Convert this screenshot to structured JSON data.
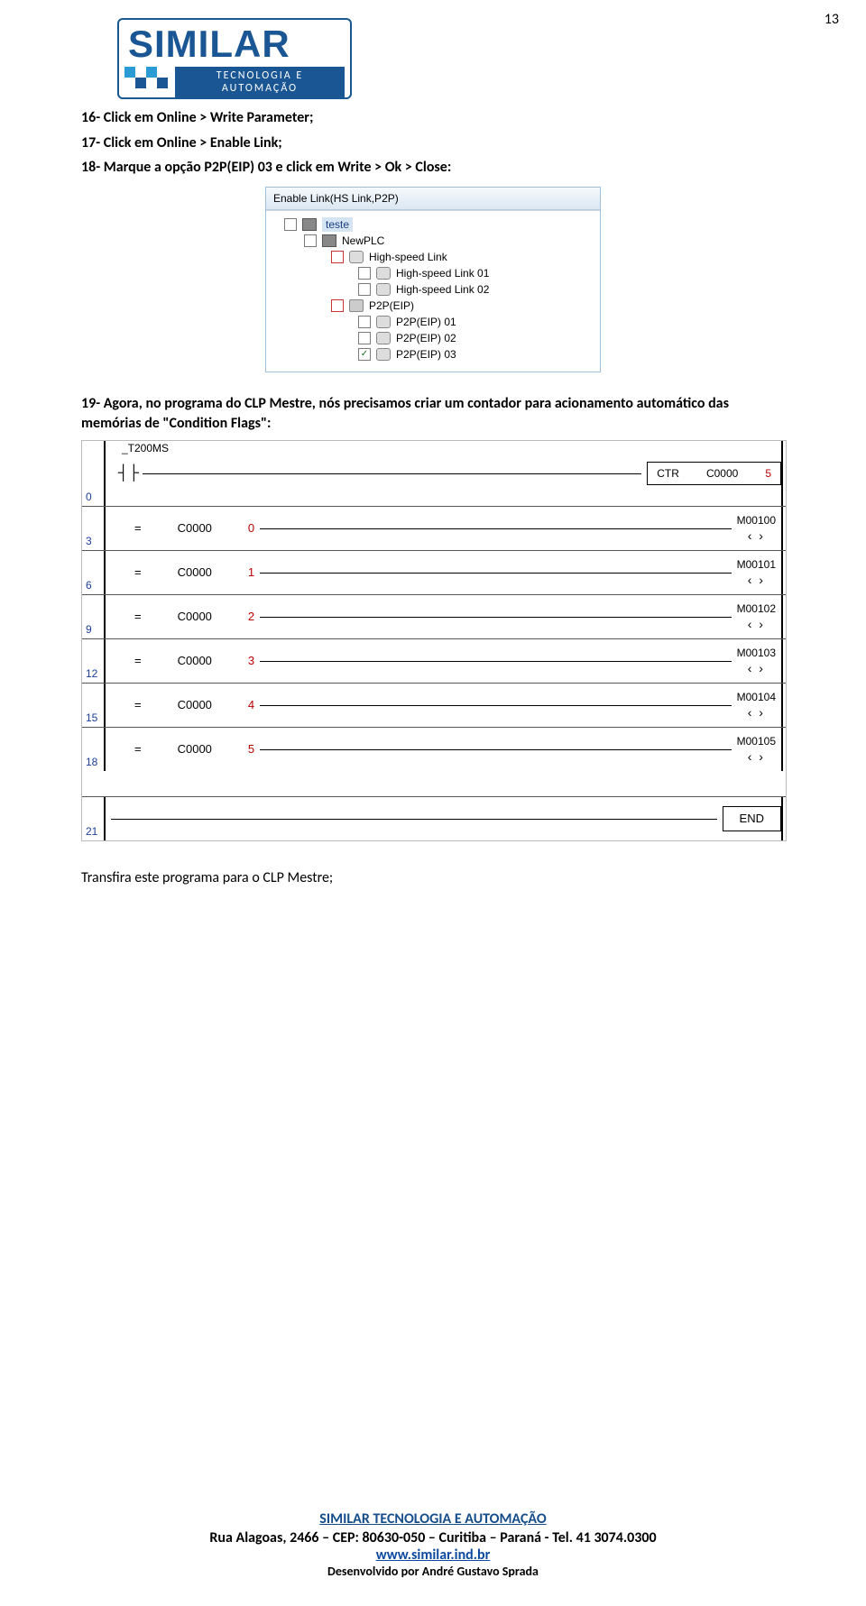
{
  "pageNumber": "13",
  "logo": {
    "main": "SIMILAR",
    "sub": "TECNOLOGIA  E  AUTOMAÇÃO"
  },
  "steps": {
    "s16": "16- Click em Online > Write Parameter;",
    "s17": "17- Click em Online > Enable Link;",
    "s18": "18- Marque a opção P2P(EIP) 03 e click em Write > Ok > Close:",
    "s19": "19- Agora, no programa do CLP Mestre, nós precisamos criar um contador para acionamento automático das memórias de \"Condition Flags\":"
  },
  "tree": {
    "title": "Enable Link(HS Link,P2P)",
    "items": [
      "teste",
      "NewPLC",
      "High-speed Link",
      "High-speed Link 01",
      "High-speed Link 02",
      "P2P(EIP)",
      "P2P(EIP) 01",
      "P2P(EIP) 02",
      "P2P(EIP) 03"
    ]
  },
  "ladder": {
    "top": {
      "num": "0",
      "cond": "_T200MS",
      "box": {
        "c1": "CTR",
        "c2": "C0000",
        "c3": "5"
      }
    },
    "rows": [
      {
        "num": "3",
        "addr": "C0000",
        "val": "0",
        "coil": "M00100"
      },
      {
        "num": "6",
        "addr": "C0000",
        "val": "1",
        "coil": "M00101"
      },
      {
        "num": "9",
        "addr": "C0000",
        "val": "2",
        "coil": "M00102"
      },
      {
        "num": "12",
        "addr": "C0000",
        "val": "3",
        "coil": "M00103"
      },
      {
        "num": "15",
        "addr": "C0000",
        "val": "4",
        "coil": "M00104"
      },
      {
        "num": "18",
        "addr": "C0000",
        "val": "5",
        "coil": "M00105"
      }
    ],
    "end": {
      "num": "21",
      "label": "END"
    }
  },
  "transfer": "Transfira este programa para o CLP Mestre;",
  "footer": {
    "company": "SIMILAR TECNOLOGIA E AUTOMAÇÃO",
    "addr": "Rua Alagoas, 2466 – CEP: 80630-050 – Curitiba – Paraná - Tel. 41 3074.0300",
    "site": "www.similar.ind.br",
    "dev": "Desenvolvido por André Gustavo Sprada"
  }
}
